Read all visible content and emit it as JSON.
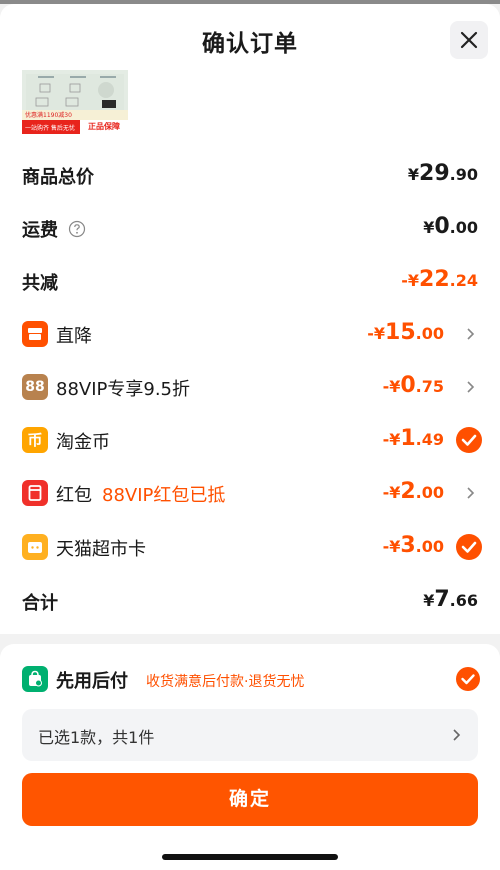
{
  "header": {
    "title": "确认订单"
  },
  "product": {
    "promo_text": "优惠满1190减30",
    "band_text": "一站购齐 售后无忧",
    "badge_text": "正品保障"
  },
  "summary": {
    "total_price": {
      "label": "商品总价",
      "currency": "¥",
      "int": "29",
      "dec": ".90"
    },
    "shipping": {
      "label": "运费",
      "currency": "¥",
      "int": "0",
      "dec": ".00"
    },
    "total_discount": {
      "label": "共减",
      "currency": "-¥",
      "int": "22",
      "dec": ".24"
    }
  },
  "discounts": [
    {
      "label": "直降",
      "currency": "-¥",
      "int": "15",
      "dec": ".00",
      "icon": "store-icon",
      "icon_color": "#ff5000",
      "control": "arrow"
    },
    {
      "label": "88VIP专享9.5折",
      "currency": "-¥",
      "int": "0",
      "dec": ".75",
      "icon": "88vip-icon",
      "icon_text": "88",
      "icon_color": "#b8824e",
      "control": "arrow"
    },
    {
      "label": "淘金币",
      "currency": "-¥",
      "int": "1",
      "dec": ".49",
      "icon": "coin-icon",
      "icon_text": "币",
      "icon_color": "#ffa500",
      "control": "check"
    },
    {
      "label": "红包",
      "extra": "88VIP红包已抵",
      "currency": "-¥",
      "int": "2",
      "dec": ".00",
      "icon": "red-packet-icon",
      "icon_color": "#f0302a",
      "control": "arrow"
    },
    {
      "label": "天猫超市卡",
      "currency": "-¥",
      "int": "3",
      "dec": ".00",
      "icon": "card-icon",
      "icon_color": "#ffb020",
      "control": "check"
    }
  ],
  "total": {
    "label": "合计",
    "currency": "¥",
    "int": "7",
    "dec": ".66"
  },
  "payment": {
    "title": "先用后付",
    "subtitle": "收货满意后付款·退货无忧",
    "selected": true
  },
  "selection": {
    "text": "已选1款，共1件"
  },
  "confirm": {
    "label": "确定"
  },
  "colors": {
    "accent": "#ff5000",
    "green": "#00b070"
  }
}
